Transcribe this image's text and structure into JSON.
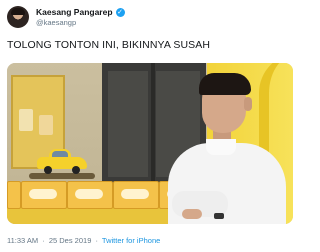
{
  "author": {
    "display_name": "Kaesang Pangarep",
    "handle": "@kaesangp",
    "verified": true
  },
  "tweet": {
    "text": "TOLONG TONTON INI, BIKINNYA SUSAH"
  },
  "meta": {
    "time": "11:33 AM",
    "separator": "·",
    "date": "25 Des 2019",
    "source": "Twitter for iPhone"
  },
  "colors": {
    "accent": "#1da1f2",
    "link": "#1b95e0",
    "secondary_text": "#657786",
    "primary_text": "#14171a"
  },
  "icons": {
    "verified": "verified-badge-icon"
  }
}
